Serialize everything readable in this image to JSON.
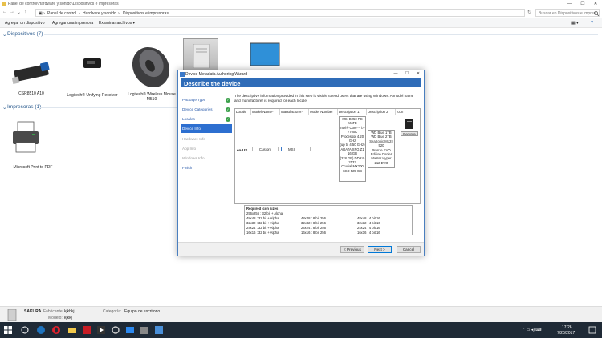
{
  "explorer": {
    "window_title": "Panel de control\\Hardware y sonido\\Dispositivos e impresoras",
    "address_crumbs": [
      "Panel de control",
      "Hardware y sonido",
      "Dispositivos e impresoras"
    ],
    "search_placeholder": "Buscar en Dispositivos e impres...",
    "toolbar": [
      "Agregar un dispositivo",
      "Agregar una impresora",
      "Examinar archivos ▾"
    ],
    "groups": {
      "devices_title": "Dispositivos (7)",
      "printers_title": "Impresoras (1)"
    },
    "devices": [
      {
        "name": "CSR8510 A10"
      },
      {
        "name": "Logitech® Unifying Receiver"
      },
      {
        "name": "Logitech® Wireless Mouse M510"
      }
    ],
    "printers": [
      {
        "name": "Microsoft Print to PDF"
      }
    ],
    "details": {
      "name": "SAKURA",
      "label_manufacturer": "Fabricante:",
      "manufacturer": "kjkhkj",
      "label_model": "Modelo:",
      "model": "kjkkj",
      "label_category": "Categoría:",
      "category": "Equipo de escritorio"
    }
  },
  "wizard": {
    "window_title": "Device Metadata Authoring Wizard",
    "header": "Describe the device",
    "description": "The descriptive information provided in this step is visible to end users that are using Windows. A model name and manufacturer is required for each locale.",
    "nav": [
      {
        "label": "Package Type",
        "state": "done"
      },
      {
        "label": "Device Categories",
        "state": "done"
      },
      {
        "label": "Locales",
        "state": "done"
      },
      {
        "label": "Device Info",
        "state": "current"
      },
      {
        "label": "Hardware Info",
        "state": "pending"
      },
      {
        "label": "App Info",
        "state": "pending"
      },
      {
        "label": "Windows Info",
        "state": "pending"
      },
      {
        "label": "Finish",
        "state": "link"
      }
    ],
    "grid": {
      "headers": [
        "Locale",
        "Model Name*",
        "Manufacturer*",
        "Model Number",
        "Description 1",
        "Description 2",
        "Icon"
      ],
      "row": {
        "locale": "en-US",
        "model_name": "Custom",
        "manufacturer": "MSI",
        "model_number": "",
        "description1": [
          "MSI B250 PC MATE",
          "Intel® Core™ i7-7700K",
          "Processor 4.20 GHz",
          "(up to 4.50 GHz)",
          "ADATA XPG Z1 16 GB",
          "(2x8 GB) DDR4-2133",
          "Crucial MX200",
          "SSD 525 GB"
        ],
        "description2": [
          "WD Blue 1TB",
          "WD Blue 2TB",
          "SeaSonic M12II 520",
          "Bronze EVO",
          "Edition Cooler",
          "Master Hyper",
          "212 EVO"
        ],
        "remove_label": "Remove"
      }
    },
    "icon_sizes": {
      "title": "Required icon sizes",
      "rows": [
        [
          "256x256 : 32 bit + Alpha",
          "",
          ""
        ],
        [
          "48x48 : 32 bit + Alpha",
          "48x48 : 8 bit 256",
          "48x48 : 4 bit 16"
        ],
        [
          "32x32 : 32 bit + Alpha",
          "32x32 : 8 bit 256",
          "32x32 : 4 bit 16"
        ],
        [
          "24x24 : 32 bit + Alpha",
          "24x24 : 8 bit 256",
          "24x24 : 4 bit 16"
        ],
        [
          "16x16 : 32 bit + Alpha",
          "16x16 : 8 bit 256",
          "16x16 : 4 bit 16"
        ]
      ]
    },
    "buttons": {
      "previous": "< Previous",
      "next": "Next >",
      "cancel": "Cancel"
    }
  },
  "taskbar": {
    "time": "17:26",
    "date": "7/20/2017"
  },
  "colors": {
    "accent": "#2f6cb8",
    "nav_selected": "#2d6fd0",
    "taskbar": "#1f2a36",
    "group_title": "#2c5c8f"
  }
}
